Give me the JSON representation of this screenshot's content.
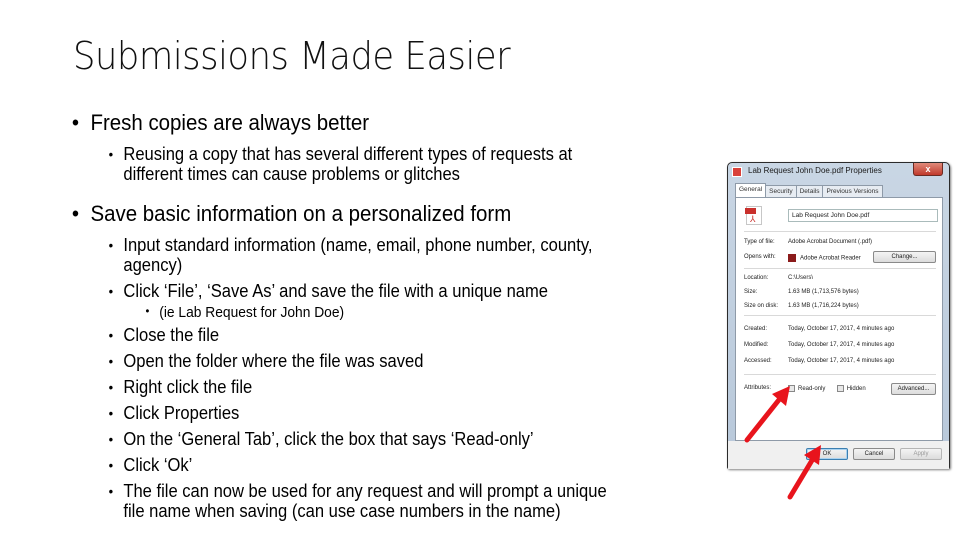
{
  "slide": {
    "title": "Submissions Made Easier",
    "bullets": [
      {
        "level": 1,
        "text": "Fresh copies are always better"
      },
      {
        "level": 2,
        "lines": [
          "Reusing a copy that has several different types of requests at",
          "different times can cause problems or glitches"
        ]
      },
      {
        "level": 1,
        "text": "Save basic information on a personalized form"
      },
      {
        "level": 2,
        "lines": [
          "Input standard information (name, email, phone number, county,",
          "agency)"
        ]
      },
      {
        "level": 2,
        "text": "Click ‘File’, ‘Save As’ and save the file with a unique name"
      },
      {
        "level": 3,
        "text": "(ie Lab Request for John Doe)"
      },
      {
        "level": 2,
        "text": "Close the file"
      },
      {
        "level": 2,
        "text": "Open the folder where the file was saved"
      },
      {
        "level": 2,
        "text": "Right click the file"
      },
      {
        "level": 2,
        "text": "Click Properties"
      },
      {
        "level": 2,
        "text": "On the ‘General Tab’, click the box that says ‘Read-only’"
      },
      {
        "level": 2,
        "text": "Click ‘Ok’"
      },
      {
        "level": 2,
        "lines": [
          "The file can now be used for any request and will prompt a unique",
          "file name when saving (can use case numbers in the name)"
        ]
      }
    ],
    "bullet_glyph": "•"
  },
  "dialog": {
    "title": "Lab Request John Doe.pdf Properties",
    "close_label": "x",
    "tabs": [
      "General",
      "Security",
      "Details",
      "Previous Versions"
    ],
    "active_tab": "General",
    "file_name": "Lab Request John Doe.pdf",
    "type_label": "Type of file:",
    "type_value": "Adobe Acrobat Document (.pdf)",
    "opens_label": "Opens with:",
    "opens_value": "Adobe Acrobat Reader",
    "change_label": "Change...",
    "location_label": "Location:",
    "location_value": "C:\\Users\\",
    "size_label": "Size:",
    "size_value": "1.63 MB (1,713,576 bytes)",
    "size_disk_label": "Size on disk:",
    "size_disk_value": "1.63 MB (1,716,224 bytes)",
    "created_label": "Created:",
    "created_value": "Today, October 17, 2017, 4 minutes ago",
    "modified_label": "Modified:",
    "modified_value": "Today, October 17, 2017, 4 minutes ago",
    "accessed_label": "Accessed:",
    "accessed_value": "Today, October 17, 2017, 4 minutes ago",
    "attributes_label": "Attributes:",
    "readonly_label": "Read-only",
    "readonly_checked": false,
    "hidden_label": "Hidden",
    "hidden_checked": false,
    "advanced_label": "Advanced...",
    "ok_label": "OK",
    "cancel_label": "Cancel",
    "apply_label": "Apply"
  },
  "annotations": {
    "arrow_color": "#e8141c",
    "arrows": [
      "points-to-read-only-checkbox",
      "points-to-ok-button"
    ]
  }
}
